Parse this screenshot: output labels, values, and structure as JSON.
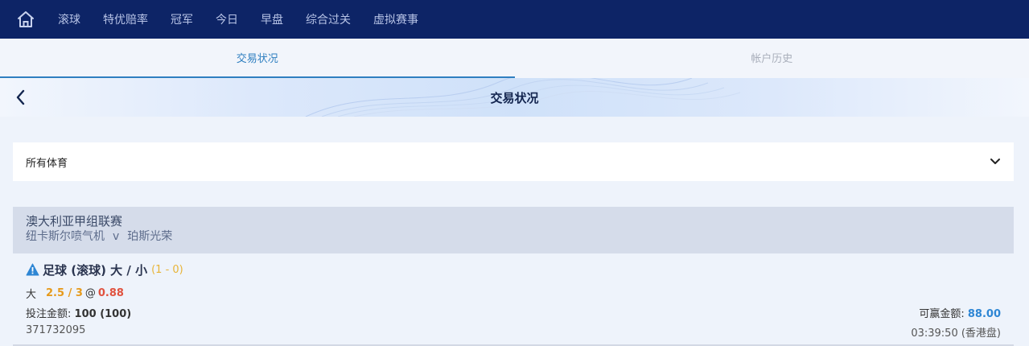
{
  "nav": {
    "items": [
      {
        "label": "滚球"
      },
      {
        "label": "特优赔率"
      },
      {
        "label": "冠军"
      },
      {
        "label": "今日"
      },
      {
        "label": "早盘"
      },
      {
        "label": "综合过关"
      },
      {
        "label": "虚拟赛事"
      }
    ]
  },
  "tabs": [
    {
      "label": "交易状况",
      "active": true
    },
    {
      "label": "帐户历史",
      "active": false
    }
  ],
  "header": {
    "title": "交易状况"
  },
  "filter": {
    "selected": "所有体育"
  },
  "league": {
    "name": "澳大利亚甲组联赛",
    "home": "纽卡斯尔喷气机",
    "vs": "v",
    "away": "珀斯光荣"
  },
  "bet": {
    "title": "足球 (滚球) 大 / 小",
    "score": "(1 - 0)",
    "selection": "大",
    "line": "2.5 / 3",
    "at": "@",
    "odds": "0.88",
    "stake_label": "投注金额:",
    "stake_value": "100 (100)",
    "win_label": "可赢金额:",
    "win_value": "88.00",
    "ticket_id": "371732095",
    "time": "03:39:50 (香港盘)"
  },
  "colors": {
    "nav_bg": "#0d2466",
    "accent": "#2f7fc0",
    "line": "#e69a1c",
    "odds": "#e0523f",
    "win": "#2e86d4",
    "score": "#e8b437"
  }
}
